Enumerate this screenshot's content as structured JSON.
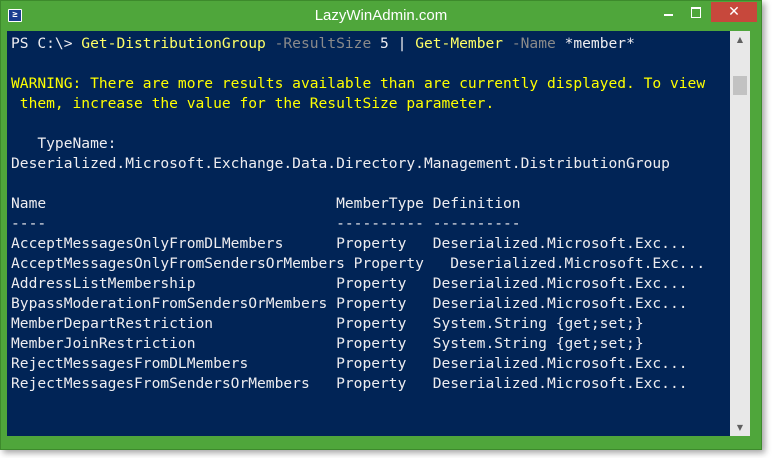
{
  "window": {
    "title": "LazyWinAdmin.com",
    "icon": "powershell-icon",
    "icon_glyph": "≥",
    "controls": {
      "minimize": "minimize-icon",
      "maximize": "maximize-icon",
      "close_label": "✕"
    },
    "colors": {
      "frame": "#4fa63b",
      "console_bg": "#012456",
      "close_button": "#c7483c",
      "warning_text": "#ffff00",
      "command_text": "#ffff66",
      "parameter_text": "#8a8a8a"
    }
  },
  "console": {
    "prompt": "PS C:\\> ",
    "cmd1": "Get-DistributionGroup",
    "param1": " -ResultSize",
    "arg1": " 5 | ",
    "cmd2": "Get-Member",
    "param2": " -Name",
    "arg2": " *member*",
    "warning_line1": "WARNING: There are more results available than are currently displayed. To view",
    "warning_line2": " them, increase the value for the ResultSize parameter.",
    "typename_label": "   TypeName:",
    "typename_value": "Deserialized.Microsoft.Exchange.Data.Directory.Management.DistributionGroup",
    "header_row": "Name                                 MemberType Definition",
    "separator_row": "----                                 ---------- ----------",
    "rows": [
      "AcceptMessagesOnlyFromDLMembers      Property   Deserialized.Microsoft.Exc...",
      "AcceptMessagesOnlyFromSendersOrMembers Property   Deserialized.Microsoft.Exc...",
      "AddressListMembership                Property   Deserialized.Microsoft.Exc...",
      "BypassModerationFromSendersOrMembers Property   Deserialized.Microsoft.Exc...",
      "MemberDepartRestriction              Property   System.String {get;set;}",
      "MemberJoinRestriction                Property   System.String {get;set;}",
      "RejectMessagesFromDLMembers          Property   Deserialized.Microsoft.Exc...",
      "RejectMessagesFromSendersOrMembers   Property   Deserialized.Microsoft.Exc..."
    ]
  },
  "scrollbar": {
    "up_arrow": "▲",
    "down_arrow": "▼"
  }
}
